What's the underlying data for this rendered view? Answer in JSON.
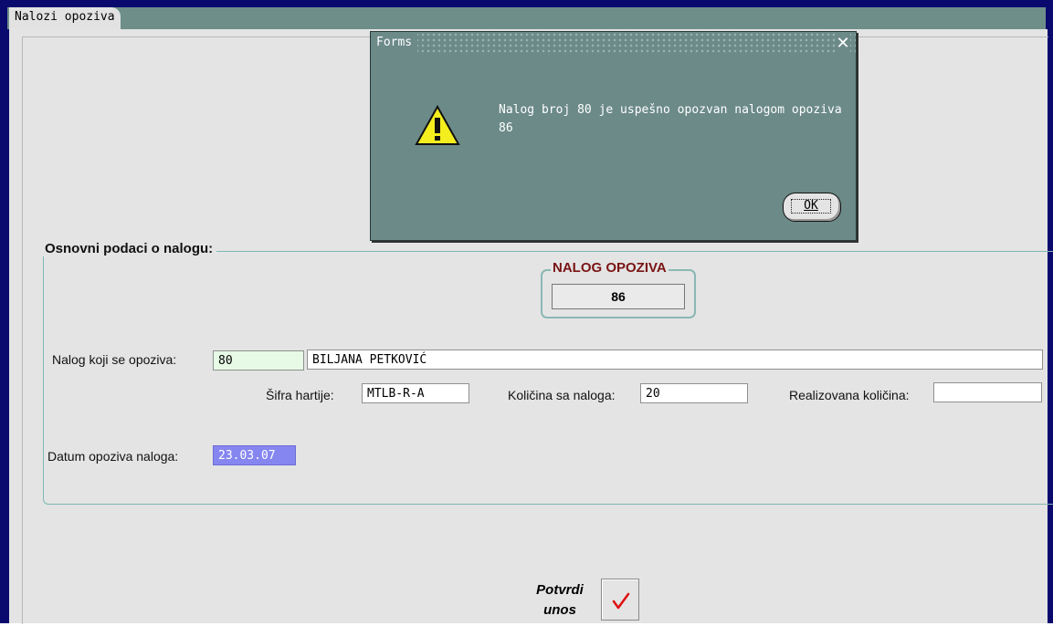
{
  "window": {
    "tab_label": "Nalozi opoziva"
  },
  "dialog": {
    "title": "Forms",
    "message": "Nalog broj 80 je uspešno opozvan nalogom opoziva 86",
    "ok_label": "OK",
    "icon": "warning-icon"
  },
  "form": {
    "section_title": "Osnovni podaci o nalogu:",
    "nalog_opoziva_title": "NALOG OPOZIVA",
    "nalog_opoziva_value": "86",
    "nalog_label": "Nalog koji se opoziva:",
    "nalog_value": "80",
    "nalog_name": "BILJANA PETKOVIĆ",
    "sifra_label": "Šifra hartije:",
    "sifra_value": "MTLB-R-A",
    "kolicina_label": "Količina sa naloga:",
    "kolicina_value": "20",
    "realizovana_label": "Realizovana količina:",
    "realizovana_value": "",
    "datum_label": "Datum opoziva naloga:",
    "datum_value": "23.03.07",
    "potvrdi_label": "Potvrdi unos"
  },
  "colors": {
    "dialog_bg": "#6b8a88",
    "nalog_title": "#7a1414",
    "selected_field": "#8686f0",
    "nalog_field": "#e6fae6",
    "check_mark": "#e01010"
  }
}
